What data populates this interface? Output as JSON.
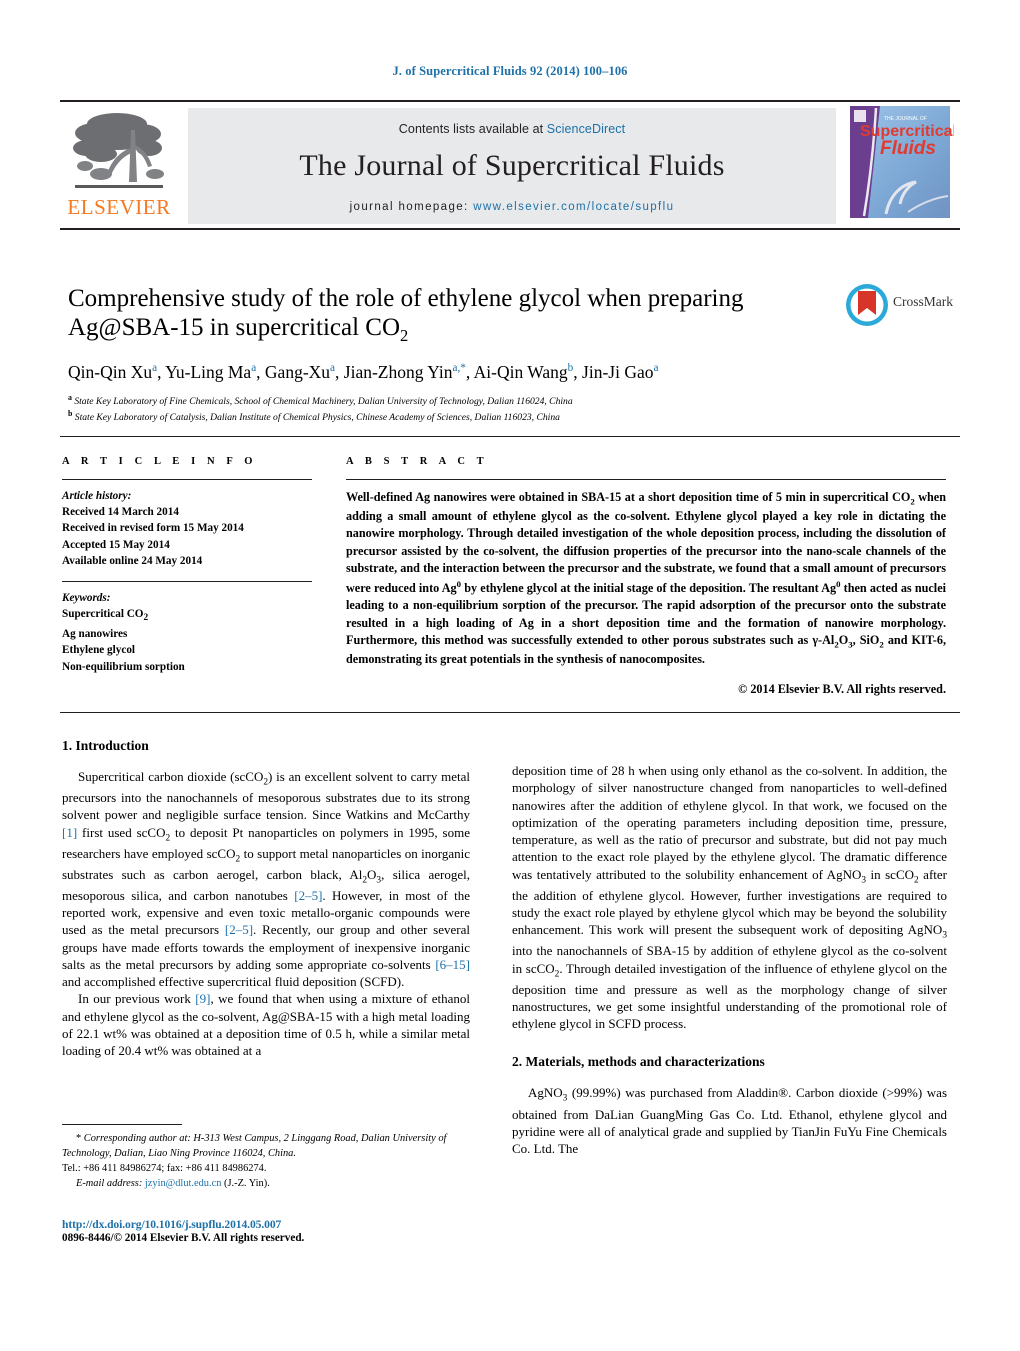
{
  "running_head": "J. of Supercritical Fluids 92 (2014) 100–106",
  "masthead": {
    "contents_prefix": "Contents lists available at ",
    "sciencedirect": "ScienceDirect",
    "journal_title": "The Journal of Supercritical Fluids",
    "homepage_label": "journal homepage: ",
    "homepage_url": "www.elsevier.com/locate/supflu",
    "publisher": "ELSEVIER",
    "cover_title_small": "THE JOURNAL OF",
    "cover_title_1": "Supercritical",
    "cover_title_2": "Fluids",
    "accent_blue": "#1d71a8",
    "publisher_orange": "#f47920",
    "band_gray": "#e7e9ea"
  },
  "article": {
    "title_line1": "Comprehensive study of the role of ethylene glycol when preparing",
    "title_line2_pre": "Ag@SBA-15 in supercritical CO",
    "title_line2_sub": "2",
    "crossmark_label": "CrossMark",
    "authors": [
      {
        "name": "Qin-Qin Xu",
        "sup": "a"
      },
      {
        "name": "Yu-Ling Ma",
        "sup": "a"
      },
      {
        "name": "Gang-Xu",
        "sup": "a"
      },
      {
        "name": "Jian-Zhong Yin",
        "sup": "a,*"
      },
      {
        "name": "Ai-Qin Wang",
        "sup": "b"
      },
      {
        "name": "Jin-Ji Gao",
        "sup": "a"
      }
    ],
    "affiliations": [
      {
        "sup": "a",
        "text": "State Key Laboratory of Fine Chemicals, School of Chemical Machinery, Dalian University of Technology, Dalian 116024, China"
      },
      {
        "sup": "b",
        "text": "State Key Laboratory of Catalysis, Dalian Institute of Chemical Physics, Chinese Academy of Sciences, Dalian 116023, China"
      }
    ]
  },
  "article_info": {
    "heading": "A R T I C L E  I N F O",
    "history_label": "Article history:",
    "history": [
      "Received 14 March 2014",
      "Received in revised form 15 May 2014",
      "Accepted 15 May 2014",
      "Available online 24 May 2014"
    ],
    "keywords_label": "Keywords:",
    "keywords": [
      "Supercritical CO2",
      "Ag nanowires",
      "Ethylene glycol",
      "Non-equilibrium sorption"
    ]
  },
  "abstract": {
    "heading": "A B S T R A C T",
    "paragraph": "Well-defined Ag nanowires were obtained in SBA-15 at a short deposition time of 5 min in supercritical CO2 when adding a small amount of ethylene glycol as the co-solvent. Ethylene glycol played a key role in dictating the nanowire morphology. Through detailed investigation of the whole deposition process, including the dissolution of precursor assisted by the co-solvent, the diffusion properties of the precursor into the nano-scale channels of the substrate, and the interaction between the precursor and the substrate, we found that a small amount of precursors were reduced into Ag0 by ethylene glycol at the initial stage of the deposition. The resultant Ag0 then acted as nuclei leading to a non-equilibrium sorption of the precursor. The rapid adsorption of the precursor onto the substrate resulted in a high loading of Ag in a short deposition time and the formation of nanowire morphology. Furthermore, this method was successfully extended to other porous substrates such as γ-Al2O3, SiO2 and KIT-6, demonstrating its great potentials in the synthesis of nanocomposites.",
    "copyright": "© 2014 Elsevier B.V. All rights reserved."
  },
  "sections": {
    "intro_heading": "1.  Introduction",
    "intro_p1": "Supercritical carbon dioxide (scCO2) is an excellent solvent to carry metal precursors into the nanochannels of mesoporous substrates due to its strong solvent power and negligible surface tension. Since Watkins and McCarthy [1] first used scCO2 to deposit Pt nanoparticles on polymers in 1995, some researchers have employed scCO2 to support metal nanoparticles on inorganic substrates such as carbon aerogel, carbon black, Al2O3, silica aerogel, mesoporous silica, and carbon nanotubes [2–5]. However, in most of the reported work, expensive and even toxic metallo-organic compounds were used as the metal precursors [2–5]. Recently, our group and other several groups have made efforts towards the employment of inexpensive inorganic salts as the metal precursors by adding some appropriate co-solvents [6–15] and accomplished effective supercritical fluid deposition (SCFD).",
    "intro_p2": "In our previous work [9], we found that when using a mixture of ethanol and ethylene glycol as the co-solvent, Ag@SBA-15 with a high metal loading of 22.1 wt% was obtained at a deposition time of 0.5 h, while a similar metal loading of 20.4 wt% was obtained at a deposition time of 28 h when using only ethanol as the co-solvent. In addition, the morphology of silver nanostructure changed from nanoparticles to well-defined nanowires after the addition of ethylene glycol. In that work, we focused on the optimization of the operating parameters including deposition time, pressure, temperature, as well as the ratio of precursor and substrate, but did not pay much attention to the exact role played by the ethylene glycol. The dramatic difference was tentatively attributed to the solubility enhancement of AgNO3 in scCO2 after the addition of ethylene glycol. However, further investigations are required to study the exact role played by ethylene glycol which may be beyond the solubility enhancement. This work will present the subsequent work of depositing AgNO3 into the nanochannels of SBA-15 by addition of ethylene glycol as the co-solvent in scCO2. Through detailed investigation of the influence of ethylene glycol on the deposition time and pressure as well as the morphology change of silver nanostructures, we get some insightful understanding of the promotional role of ethylene glycol in SCFD process.",
    "materials_heading": "2.  Materials, methods and characterizations",
    "materials_p1": "AgNO3 (99.99%) was purchased from Aladdin®. Carbon dioxide (>99%) was obtained from DaLian GuangMing Gas Co. Ltd. Ethanol, ethylene glycol and pyridine were all of analytical grade and supplied by TianJin FuYu Fine Chemicals Co. Ltd. The"
  },
  "footer": {
    "corresponding_marker": "*",
    "corresponding": " Corresponding author at: H-313 West Campus, 2 Linggang Road, Dalian University of Technology, Dalian, Liao Ning Province 116024, China.",
    "tel": "Tel.: +86 411 84986274; fax: +86 411 84986274.",
    "email_label": "E-mail address:",
    "email": "jzyin@dlut.edu.cn",
    "email_owner": "(J.-Z. Yin).",
    "doi": "http://dx.doi.org/10.1016/j.supflu.2014.05.007",
    "issn": "0896-8446/© 2014 Elsevier B.V. All rights reserved."
  }
}
